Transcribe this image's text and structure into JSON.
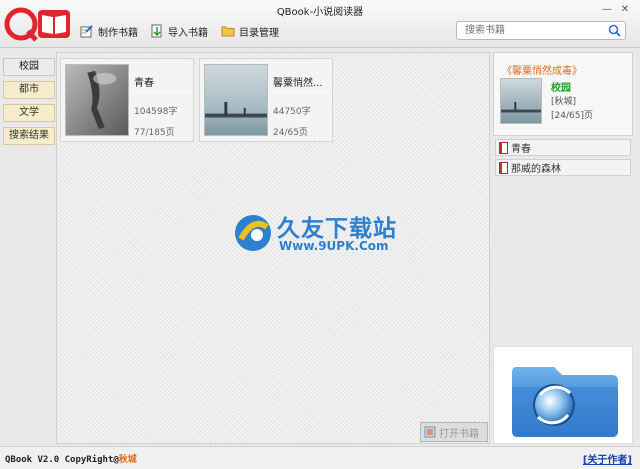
{
  "app": {
    "logo_text": "QB",
    "title": "QBook-小说阅读器"
  },
  "toolbar": {
    "make_book": "制作书籍",
    "import_book": "导入书籍",
    "catalog": "目录管理"
  },
  "search": {
    "placeholder": "搜索书籍",
    "value": ""
  },
  "sidebar": {
    "items": [
      {
        "label": "校园",
        "active": true
      },
      {
        "label": "都市",
        "active": false
      },
      {
        "label": "文学",
        "active": false
      },
      {
        "label": "搜索结果",
        "active": false
      }
    ]
  },
  "books": [
    {
      "title": "青春",
      "words": "104598字",
      "pages": "77/185页"
    },
    {
      "title": "馨粟悄然...",
      "words": "44750字",
      "pages": "24/65页"
    }
  ],
  "watermark": {
    "name": "久友下载站",
    "url": "Www.9UPK.Com"
  },
  "open_button": "打开书籍",
  "current_book": {
    "title": "《馨粟悄然成毒》",
    "category": "校园",
    "author": "[秋城]",
    "pages": "[24/65]页"
  },
  "bookmarks": [
    "青春",
    "那威的森林"
  ],
  "footer": {
    "copyright": "QBook V2.0 CopyRight@",
    "author": "秋城",
    "about": "[关于作者]"
  },
  "colors": {
    "accent_red": "#e0262d",
    "orange": "#e36a1b",
    "green": "#20a020",
    "link_blue": "#1a3fb0"
  }
}
